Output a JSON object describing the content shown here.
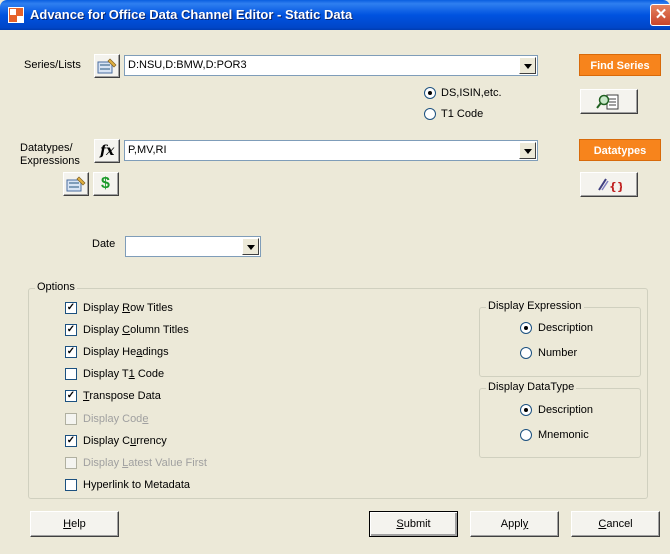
{
  "window": {
    "title": "Advance for Office Data Channel Editor - Static Data",
    "close_glyph": "✕"
  },
  "series": {
    "label": "Series/Lists",
    "value": "D:NSU,D:BMW,D:POR3",
    "find_button": "Find Series",
    "radio_options": [
      {
        "label": "DS,ISIN,etc.",
        "selected": true
      },
      {
        "label": "T1 Code",
        "selected": false
      }
    ]
  },
  "datatypes": {
    "label_line1": "Datatypes/",
    "label_line2": "Expressions",
    "fx_glyph": "fx",
    "value": "P,MV,RI",
    "button": "Datatypes",
    "dollar_glyph": "$"
  },
  "date": {
    "label": "Date",
    "value": ""
  },
  "options": {
    "title": "Options",
    "checkboxes": [
      {
        "pre": "Display ",
        "key": "R",
        "post": "ow Titles",
        "checked": true,
        "disabled": false
      },
      {
        "pre": "Display ",
        "key": "C",
        "post": "olumn Titles",
        "checked": true,
        "disabled": false
      },
      {
        "pre": "Display He",
        "key": "a",
        "post": "dings",
        "checked": true,
        "disabled": false
      },
      {
        "pre": "Display T",
        "key": "1",
        "post": " Code",
        "checked": false,
        "disabled": false
      },
      {
        "pre": "",
        "key": "T",
        "post": "ranspose Data",
        "checked": true,
        "disabled": false
      },
      {
        "pre": "Display Cod",
        "key": "e",
        "post": "",
        "checked": false,
        "disabled": true
      },
      {
        "pre": "Display C",
        "key": "u",
        "post": "rrency",
        "checked": true,
        "disabled": false
      },
      {
        "pre": "Display ",
        "key": "L",
        "post": "atest Value First",
        "checked": false,
        "disabled": true
      },
      {
        "pre": "Hyperlink to Metadata",
        "key": "",
        "post": "",
        "checked": false,
        "disabled": false
      }
    ],
    "display_expression": {
      "title": "Display Expression",
      "options": [
        {
          "label": "Description",
          "selected": true
        },
        {
          "label": "Number",
          "selected": false
        }
      ]
    },
    "display_datatype": {
      "title": "Display DataType",
      "options": [
        {
          "label": "Description",
          "selected": true
        },
        {
          "label": "Mnemonic",
          "selected": false
        }
      ]
    }
  },
  "buttons": {
    "help": {
      "key": "H",
      "rest": "elp"
    },
    "submit": {
      "key": "S",
      "rest": "ubmit"
    },
    "apply": {
      "key": "",
      "pre": "Appl",
      "post": "y"
    },
    "cancel": {
      "key": "C",
      "rest": "ancel"
    }
  },
  "colors": {
    "accent_orange": "#f7841c",
    "titlebar_blue": "#0053e0",
    "dialog_bg": "#ece9d8"
  }
}
